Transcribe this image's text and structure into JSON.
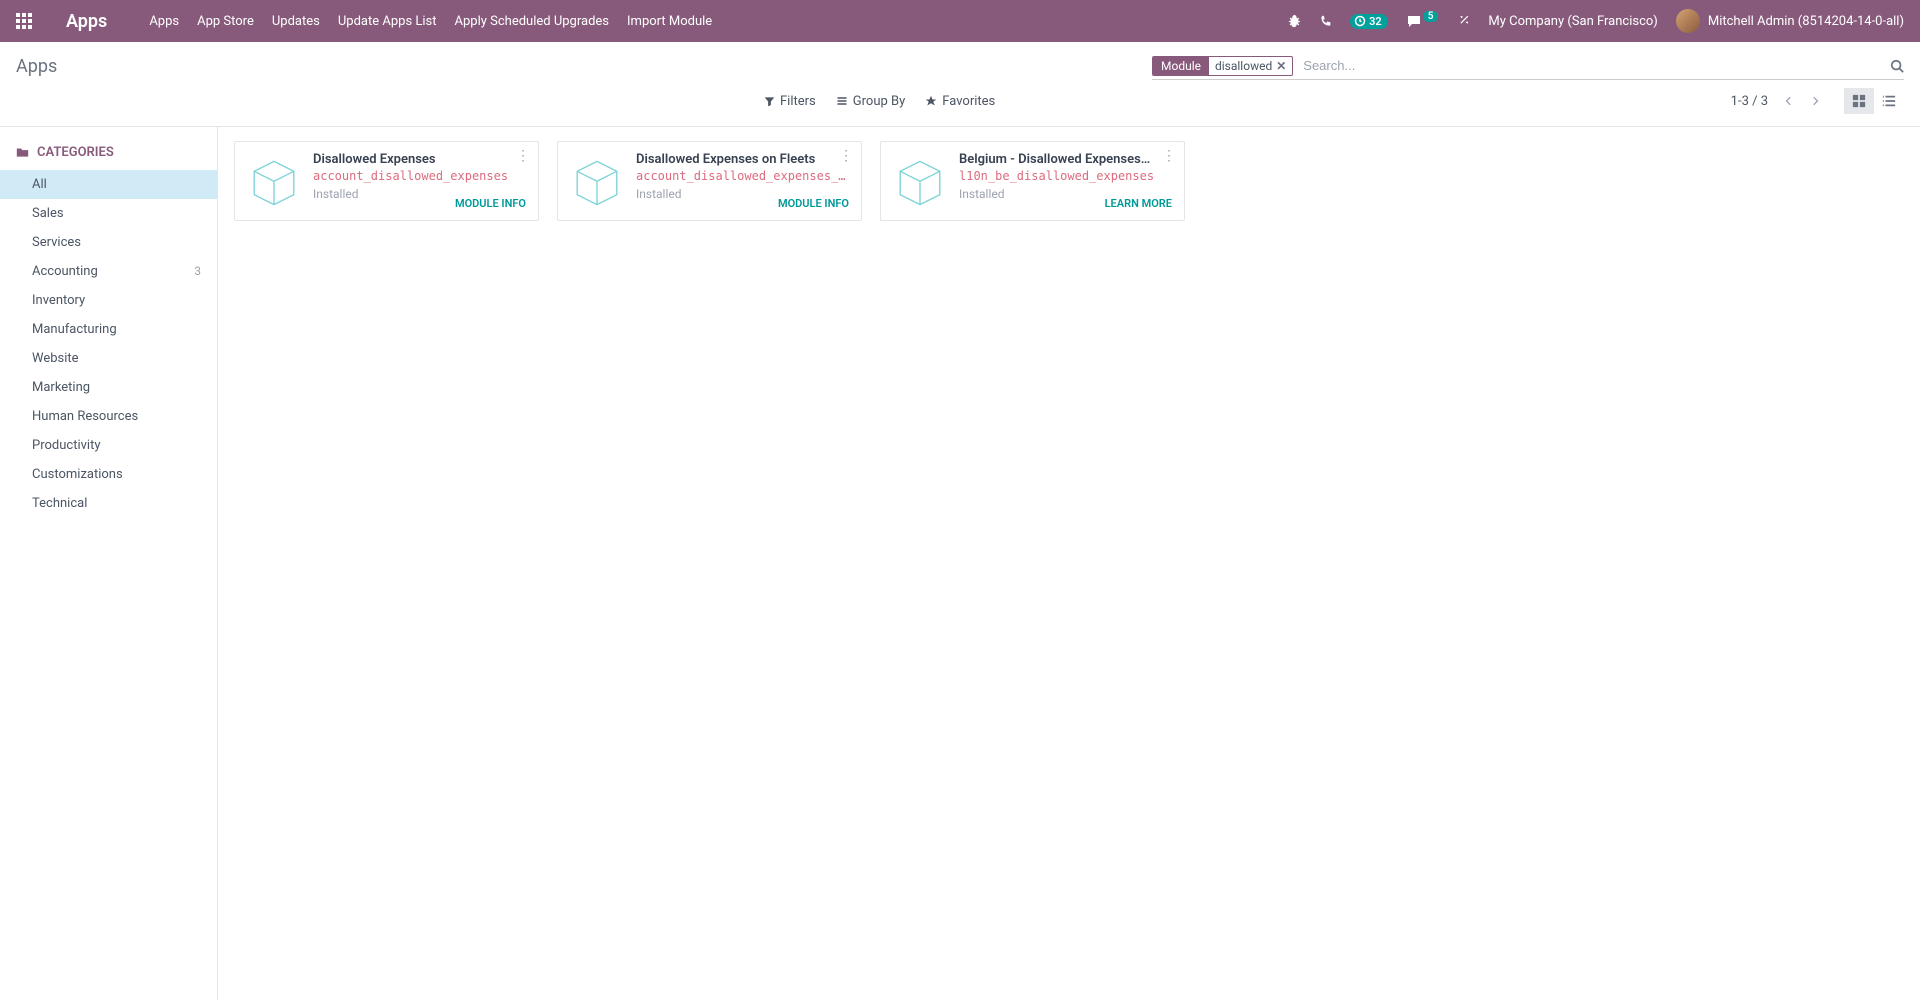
{
  "navbar": {
    "brand": "Apps",
    "links": [
      "Apps",
      "App Store",
      "Updates",
      "Update Apps List",
      "Apply Scheduled Upgrades",
      "Import Module"
    ],
    "clock_badge": "32",
    "msg_badge": "5",
    "company": "My Company (San Francisco)",
    "user": "Mitchell Admin (8514204-14-0-all)"
  },
  "breadcrumb": "Apps",
  "search": {
    "facet_label": "Module",
    "facet_value": "disallowed",
    "placeholder": "Search..."
  },
  "filters": {
    "filters": "Filters",
    "groupby": "Group By",
    "favorites": "Favorites"
  },
  "pager": "1-3 / 3",
  "sidebar": {
    "header": "CATEGORIES",
    "items": [
      {
        "label": "All",
        "count": "",
        "active": true
      },
      {
        "label": "Sales",
        "count": ""
      },
      {
        "label": "Services",
        "count": ""
      },
      {
        "label": "Accounting",
        "count": "3"
      },
      {
        "label": "Inventory",
        "count": ""
      },
      {
        "label": "Manufacturing",
        "count": ""
      },
      {
        "label": "Website",
        "count": ""
      },
      {
        "label": "Marketing",
        "count": ""
      },
      {
        "label": "Human Resources",
        "count": ""
      },
      {
        "label": "Productivity",
        "count": ""
      },
      {
        "label": "Customizations",
        "count": ""
      },
      {
        "label": "Technical",
        "count": ""
      }
    ]
  },
  "cards": [
    {
      "title": "Disallowed Expenses",
      "tech": "account_disallowed_expenses",
      "status": "Installed",
      "action": "MODULE INFO"
    },
    {
      "title": "Disallowed Expenses on Fleets",
      "tech": "account_disallowed_expenses_fleet",
      "status": "Installed",
      "action": "MODULE INFO"
    },
    {
      "title": "Belgium - Disallowed Expenses…",
      "tech": "l10n_be_disallowed_expenses",
      "status": "Installed",
      "action": "LEARN MORE"
    }
  ]
}
